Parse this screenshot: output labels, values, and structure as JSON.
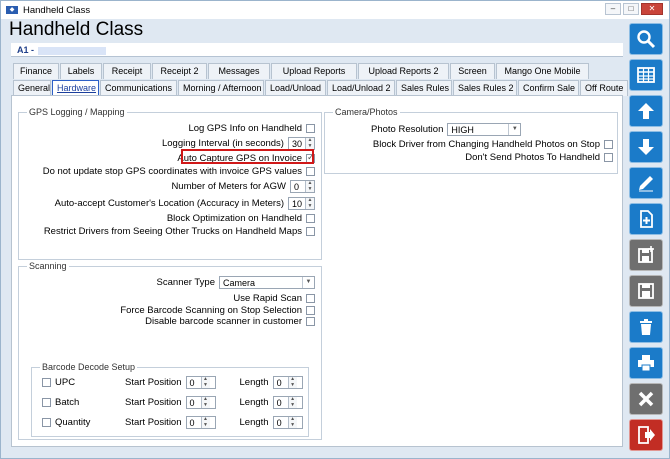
{
  "window": {
    "title": "Handheld Class",
    "controls": [
      "–",
      "□",
      "✕"
    ]
  },
  "page_title": "Handheld Class",
  "record_label": "A1 -",
  "tabs_row1": [
    "Finance",
    "Labels",
    "Receipt",
    "Receipt 2",
    "Messages",
    "Upload Reports",
    "Upload Reports 2",
    "Screen",
    "Mango One Mobile"
  ],
  "tabs_row2": [
    "General",
    "Hardware",
    "Communications",
    "Morning / Afternoon",
    "Load/Unload",
    "Load/Unload 2",
    "Sales Rules",
    "Sales Rules 2",
    "Confirm Sale",
    "Off Route"
  ],
  "active_tab": "Hardware",
  "gps": {
    "legend": "GPS Logging / Mapping",
    "log_gps_info": {
      "label": "Log GPS Info on Handheld",
      "checked": false
    },
    "logging_interval": {
      "label": "Logging Interval (in seconds)",
      "value": "30"
    },
    "auto_capture": {
      "label": "Auto Capture GPS on Invoice",
      "checked": true
    },
    "no_update_stop": {
      "label": "Do not update stop GPS coordinates with invoice GPS values",
      "checked": false
    },
    "meters_for_agw": {
      "label": "Number of Meters for AGW",
      "value": "0"
    },
    "auto_accept": {
      "label": "Auto-accept Customer's Location (Accuracy in Meters)",
      "value": "10"
    },
    "block_optimization": {
      "label": "Block Optimization on Handheld",
      "checked": false
    },
    "restrict_drivers": {
      "label": "Restrict Drivers from Seeing Other Trucks on Handheld Maps",
      "checked": false
    }
  },
  "camera": {
    "legend": "Camera/Photos",
    "resolution": {
      "label": "Photo Resolution",
      "value": "HIGH"
    },
    "block_driver": {
      "label": "Block Driver from Changing Handheld Photos on Stop",
      "checked": false
    },
    "dont_send": {
      "label": "Don't Send Photos To Handheld",
      "checked": false
    }
  },
  "scanning": {
    "legend": "Scanning",
    "scanner_type": {
      "label": "Scanner Type",
      "value": "Camera"
    },
    "rapid_scan": {
      "label": "Use Rapid Scan",
      "checked": false
    },
    "force_barcode": {
      "label": "Force Barcode Scanning on Stop Selection",
      "checked": false
    },
    "disable_scanner": {
      "label": "Disable barcode scanner in customer",
      "checked": false
    }
  },
  "barcode": {
    "legend": "Barcode Decode Setup",
    "start_label": "Start Position",
    "length_label": "Length",
    "rows": [
      {
        "name": "UPC",
        "start": "0",
        "length": "0"
      },
      {
        "name": "Batch",
        "start": "0",
        "length": "0"
      },
      {
        "name": "Quantity",
        "start": "0",
        "length": "0"
      }
    ]
  },
  "toolbar": [
    "search-icon",
    "grid-icon",
    "arrow-up-icon",
    "arrow-down-icon",
    "pencil-icon",
    "new-document-icon",
    "save-new-icon",
    "save-icon",
    "trash-icon",
    "print-icon",
    "close-icon",
    "exit-icon"
  ],
  "colors": {
    "accent": "#1b7bc9",
    "highlight": "#d01818",
    "gray_button": "#6f6f6f",
    "exit_button": "#c22d24"
  }
}
